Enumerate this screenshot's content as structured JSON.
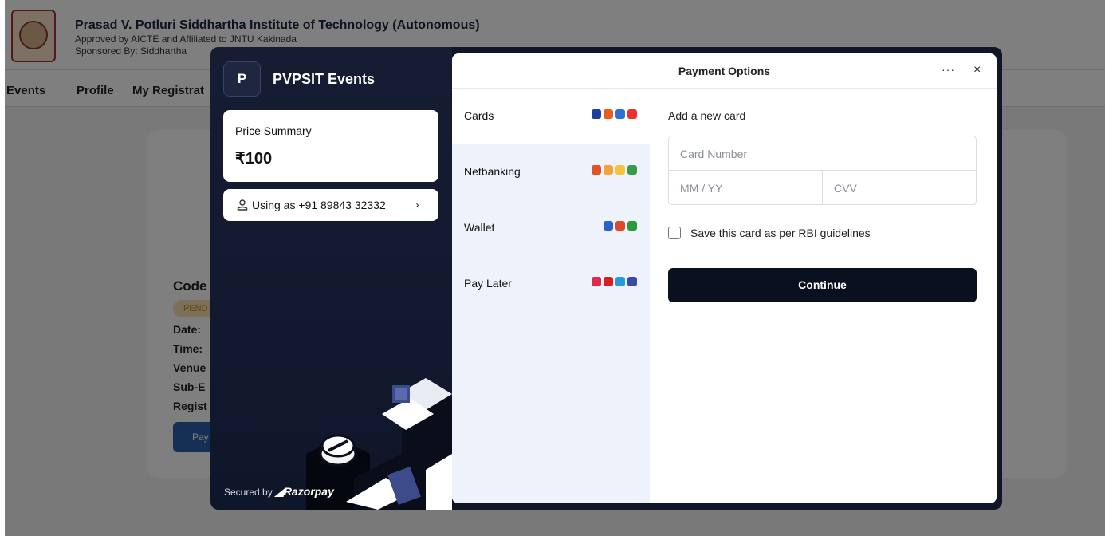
{
  "background": {
    "institute_title": "Prasad V. Potluri Siddhartha Institute of Technology (Autonomous)",
    "approved_text": "Approved by AICTE and Affiliated to JNTU Kakinada",
    "sponsored_text": "Sponsored By: Siddhartha",
    "nav": [
      "Events",
      "Profile",
      "My Registrat"
    ],
    "event_card": {
      "code_label": "Code",
      "status_badge": "PEND",
      "date_label": "Date:",
      "time_label": "Time:",
      "venue_label": "Venue",
      "sub_label": "Sub-E",
      "regist_label": "Regist",
      "pay_button": "Pay"
    }
  },
  "checkout": {
    "merchant_initial": "P",
    "merchant_name": "PVPSIT Events",
    "price_summary_label": "Price Summary",
    "price_amount": "₹100",
    "using_as": "Using as +91 89843 32332",
    "secured_by": "Secured by",
    "razorpay_brand": "Razorpay",
    "header_title": "Payment Options",
    "more_label": "···",
    "close_label": "×",
    "methods": [
      {
        "label": "Cards",
        "icons": [
          "visa-icon",
          "mastercard-icon",
          "rupay-icon",
          "maestro-icon"
        ],
        "colors": [
          "#1a3f9c",
          "#eb5a1e",
          "#2e6fd1",
          "#e8332a"
        ]
      },
      {
        "label": "Netbanking",
        "icons": [
          "bank-hdfc-icon",
          "bank-axis-icon",
          "bank-icici-icon",
          "bank-sbi-icon"
        ],
        "colors": [
          "#e0532a",
          "#f4a23c",
          "#f5c242",
          "#3a9a4a"
        ]
      },
      {
        "label": "Wallet",
        "icons": [
          "mobikwik-icon",
          "freecharge-icon",
          "olamoney-icon"
        ],
        "colors": [
          "#2a62c9",
          "#e04a2a",
          "#2a9a3a"
        ]
      },
      {
        "label": "Pay Later",
        "icons": [
          "paylater-icon-1",
          "paylater-icon-2",
          "paylater-icon-3",
          "paylater-icon-4"
        ],
        "colors": [
          "#e02a4a",
          "#d81e1e",
          "#2a9ad8",
          "#3a4aa8"
        ]
      }
    ],
    "add_card_title": "Add a new card",
    "card_number_placeholder": "Card Number",
    "expiry_placeholder": "MM / YY",
    "cvv_placeholder": "CVV",
    "save_card_label": "Save this card as per RBI guidelines",
    "continue_label": "Continue"
  }
}
